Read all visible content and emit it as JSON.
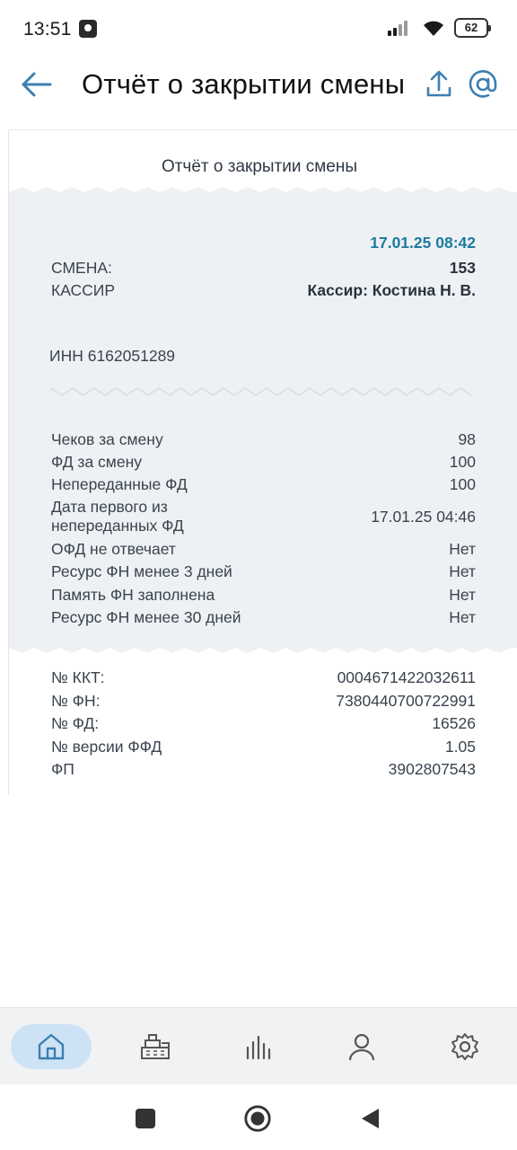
{
  "status_bar": {
    "time": "13:51",
    "battery": "62"
  },
  "header": {
    "title": "Отчёт о закрытии смены",
    "icons": [
      "back-arrow-icon",
      "share-upload-icon",
      "at-email-icon"
    ]
  },
  "receipt": {
    "title": "Отчёт о закрытии смены",
    "datetime": "17.01.25 08:42",
    "shift_label": "СМЕНА:",
    "shift_value": "153",
    "cashier_label": "КАССИР",
    "cashier_value": "Кассир: Костина Н. В.",
    "inn": "ИНН 6162051289",
    "stats": [
      {
        "label": "Чеков за смену",
        "value": "98"
      },
      {
        "label": "ФД за смену",
        "value": "100"
      },
      {
        "label": "Непереданные ФД",
        "value": "100"
      },
      {
        "label_line1": "Дата первого из",
        "label_line2": "непереданных ФД",
        "value": "17.01.25 04:46"
      },
      {
        "label": "ОФД не отвечает",
        "value": "Нет"
      },
      {
        "label": "Ресурс ФН менее 3 дней",
        "value": "Нет"
      },
      {
        "label": "Память ФН заполнена",
        "value": "Нет"
      },
      {
        "label": "Ресурс ФН менее 30 дней",
        "value": "Нет"
      }
    ],
    "fiscal": [
      {
        "label": "№ ККТ:",
        "value": "0004671422032611"
      },
      {
        "label": "№ ФН:",
        "value": "7380440700722991"
      },
      {
        "label": "№ ФД:",
        "value": "16526"
      },
      {
        "label": "№ версии ФФД",
        "value": "1.05"
      },
      {
        "label": "ФП",
        "value": "3902807543"
      }
    ]
  },
  "bottom_nav": {
    "items": [
      "home-icon",
      "cash-register-icon",
      "chart-icon",
      "profile-icon",
      "settings-icon"
    ],
    "active": "home-icon",
    "accent": "#cde3f5"
  },
  "system_nav": [
    "recent-apps-icon",
    "home-circle-icon",
    "back-triangle-icon"
  ],
  "colors": {
    "accent_date": "#1c7aa0",
    "receipt_bg": "#eef1f4",
    "icon": "#3c7fb1"
  }
}
